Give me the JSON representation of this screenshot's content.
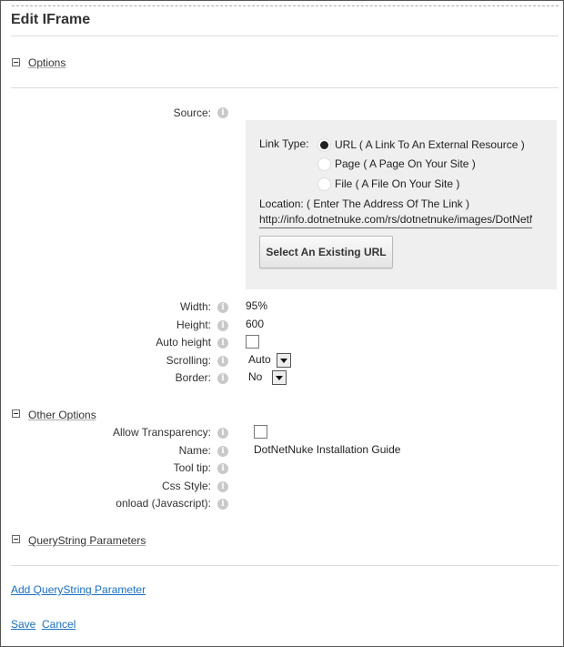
{
  "title": "Edit IFrame",
  "sections": {
    "options": "Options",
    "other_options": "Other Options",
    "querystring": "QueryString Parameters"
  },
  "source": {
    "label": "Source:",
    "link_type_label": "Link Type:",
    "options": [
      {
        "label": "URL ( A Link To An External Resource )",
        "selected": true
      },
      {
        "label": "Page ( A Page On Your Site )",
        "selected": false
      },
      {
        "label": "File ( A File On Your Site )",
        "selected": false
      }
    ],
    "location_label": "Location: ( Enter The Address Of The Link )",
    "url_value": "http://info.dotnetnuke.com/rs/dotnetnuke/images/DotNetNuke",
    "select_button": "Select An Existing URL"
  },
  "fields": {
    "width_label": "Width:",
    "width_value": "95%",
    "height_label": "Height:",
    "height_value": "600",
    "auto_height_label": "Auto height",
    "auto_height_checked": false,
    "scrolling_label": "Scrolling:",
    "scrolling_value": "Auto",
    "border_label": "Border:",
    "border_value": "No"
  },
  "other": {
    "transparency_label": "Allow Transparency:",
    "transparency_checked": false,
    "name_label": "Name:",
    "name_value": "DotNetNuke Installation Guide",
    "tooltip_label": "Tool tip:",
    "css_label": "Css Style:",
    "onload_label": "onload (Javascript):"
  },
  "links": {
    "add_querystring": "Add QueryString Parameter",
    "save": "Save",
    "cancel": "Cancel"
  },
  "icons": {
    "info": "i"
  }
}
